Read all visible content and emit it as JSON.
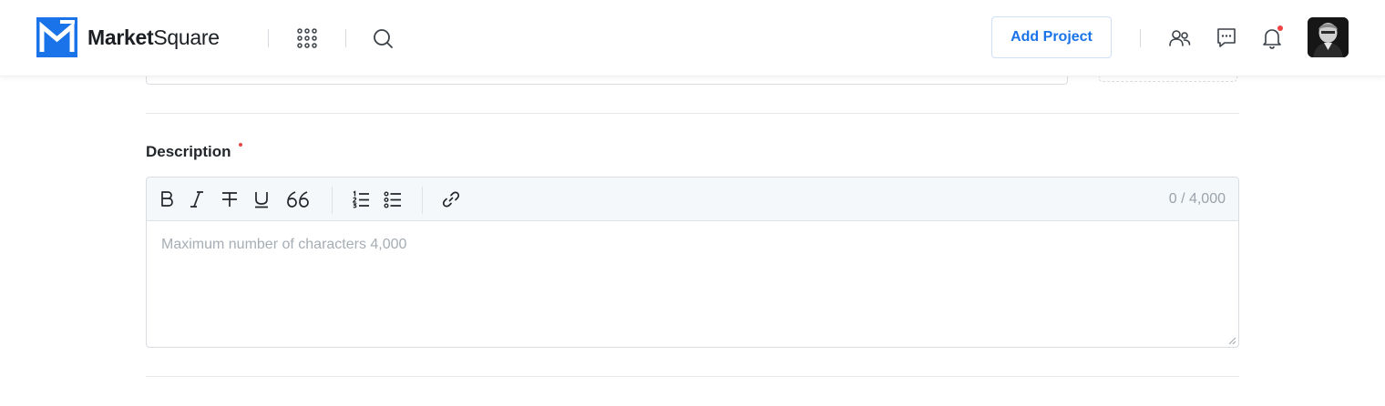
{
  "header": {
    "brand_bold": "Market",
    "brand_light": "Square",
    "add_project_label": "Add Project",
    "brand_color": "#1a73e8",
    "notification_dot_color": "#ef4444",
    "icons": [
      "apps-grid-icon",
      "search-icon",
      "users-icon",
      "chat-icon",
      "bell-icon"
    ]
  },
  "form": {
    "description_label": "Description",
    "required": true,
    "editor": {
      "toolbar_icons": [
        "bold-icon",
        "italic-icon",
        "strikethrough-icon",
        "underline-icon",
        "quote-icon",
        "ordered-list-icon",
        "bullet-list-icon",
        "link-icon"
      ],
      "counter": "0 / 4,000",
      "placeholder": "Maximum number of characters 4,000",
      "value": ""
    }
  }
}
